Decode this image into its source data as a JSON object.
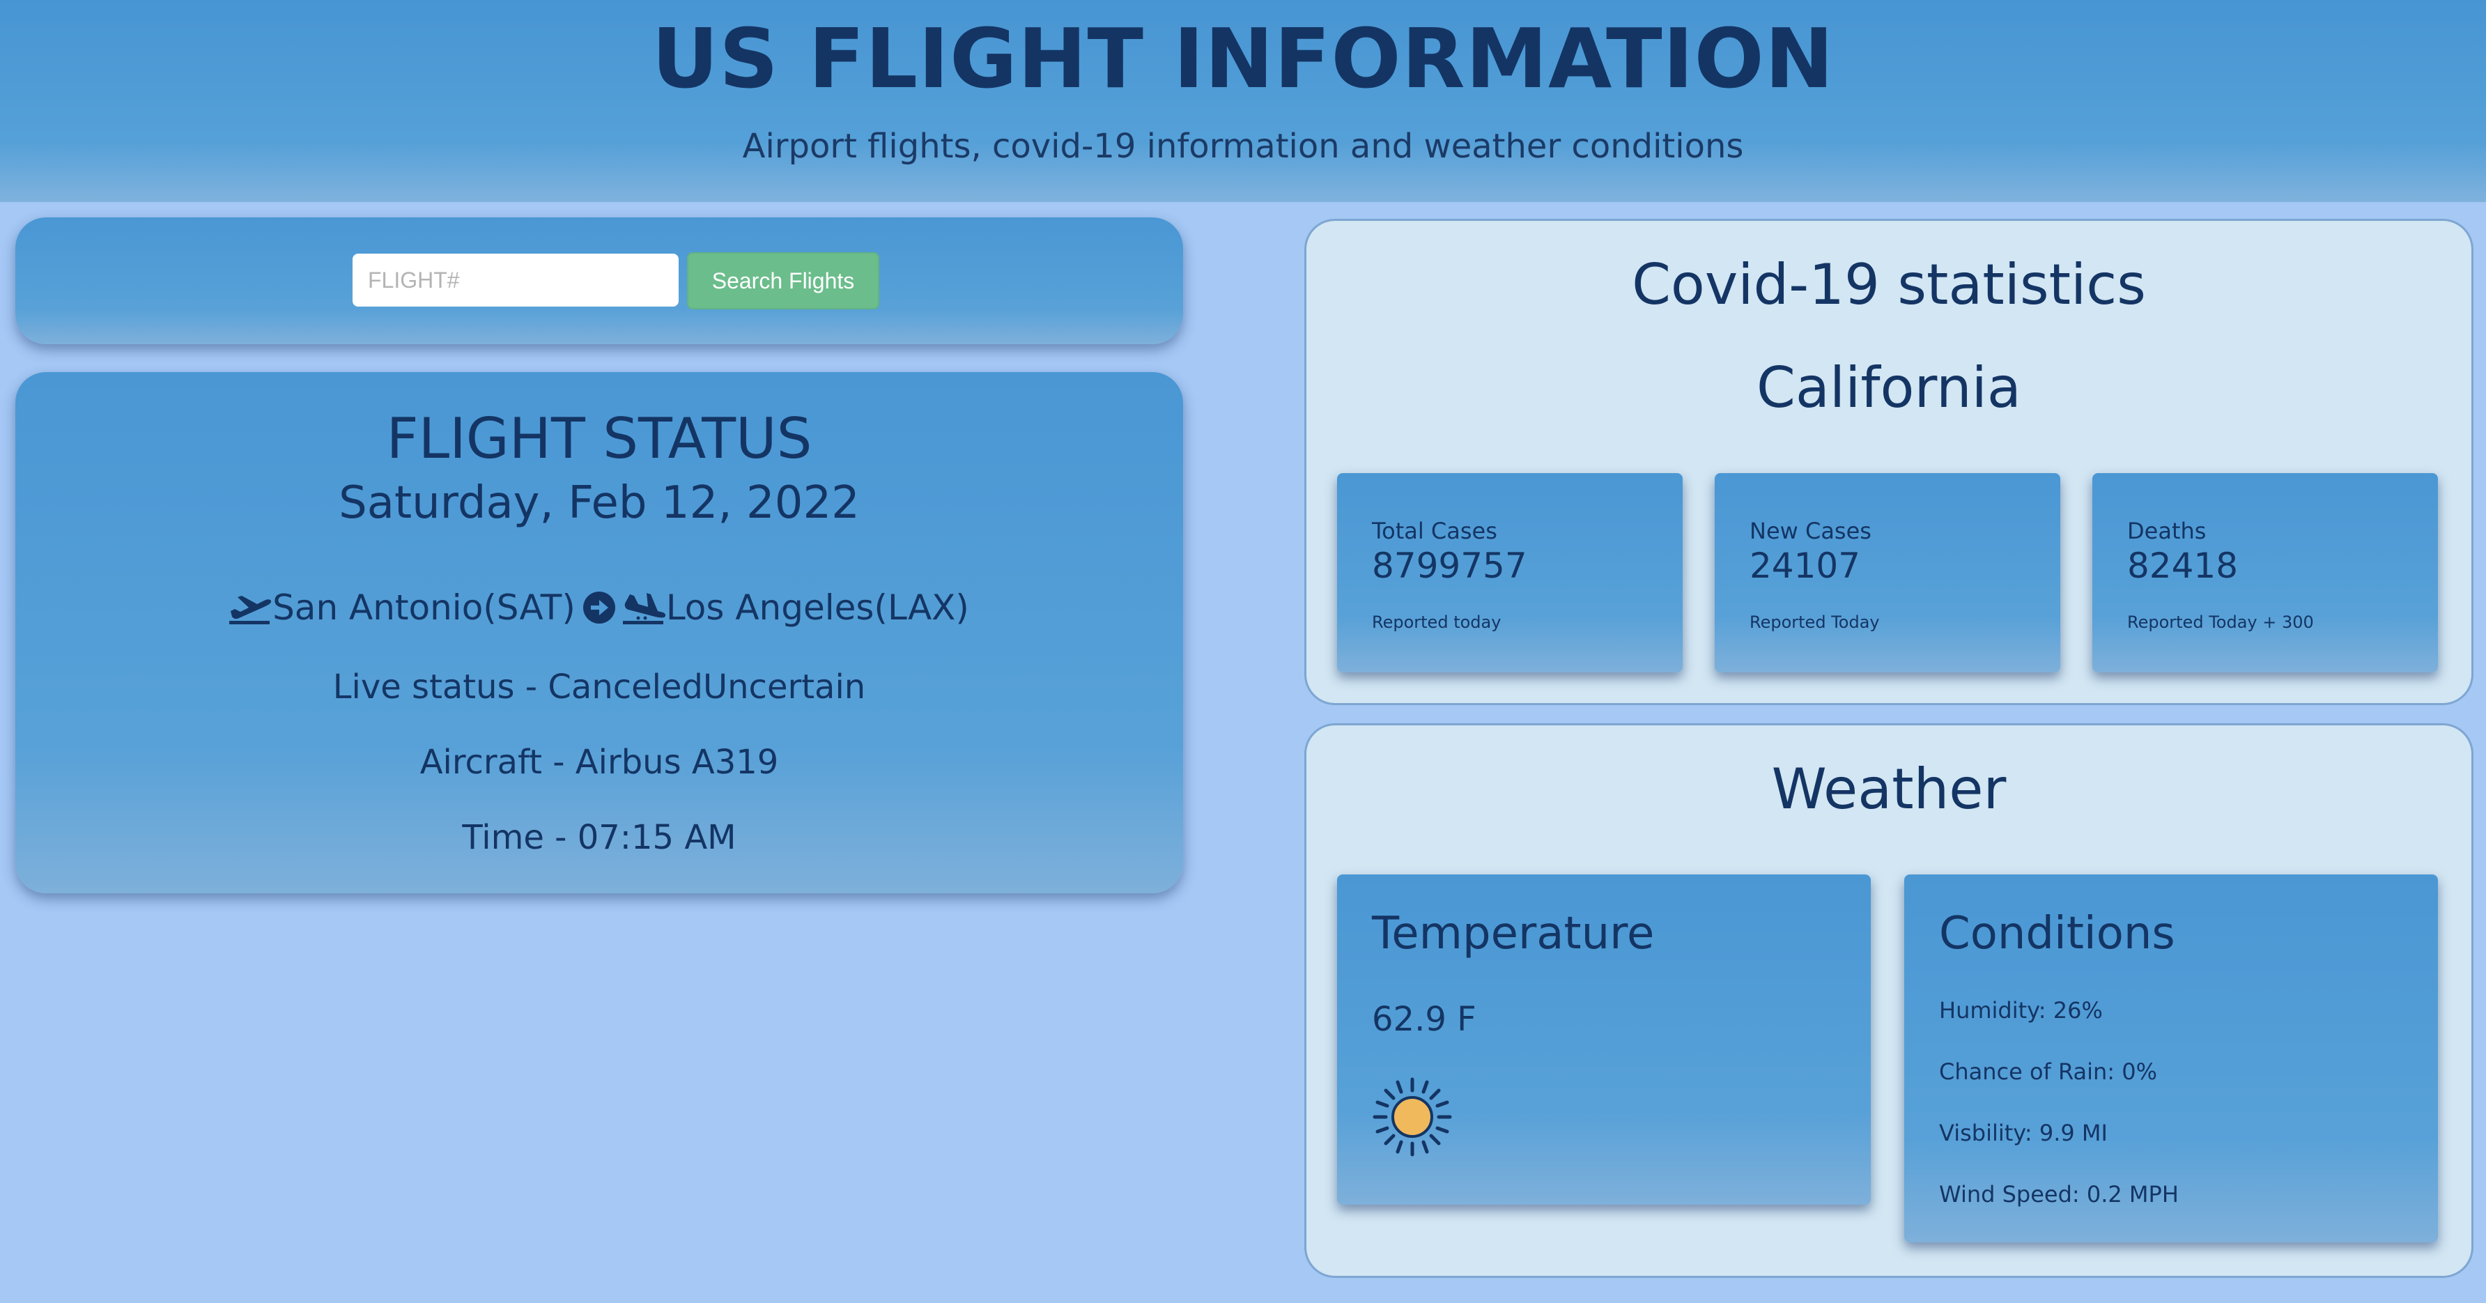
{
  "header": {
    "title": "US FLIGHT INFORMATION",
    "subtitle": "Airport flights, covid-19 information and weather conditions"
  },
  "search": {
    "placeholder": "FLIGHT#",
    "value": "",
    "button_label": "Search Flights"
  },
  "flight": {
    "heading": "FLIGHT STATUS",
    "date": "Saturday, Feb 12, 2022",
    "origin": "San Antonio(SAT)",
    "destination": "Los Angeles(LAX)",
    "live_status": "Live status - CanceledUncertain",
    "aircraft": "Aircraft - Airbus A319",
    "time": "Time - 07:15 AM",
    "icons": [
      "plane-departure-icon",
      "arrow-circle-right-icon",
      "plane-arrival-icon"
    ]
  },
  "covid": {
    "title": "Covid-19 statistics",
    "region": "California",
    "cards": [
      {
        "label": "Total Cases",
        "value": "8799757",
        "note": "Reported today"
      },
      {
        "label": "New Cases",
        "value": "24107",
        "note": "Reported Today"
      },
      {
        "label": "Deaths",
        "value": "82418",
        "note": "Reported Today + 300"
      }
    ]
  },
  "weather": {
    "title": "Weather",
    "temperature": {
      "heading": "Temperature",
      "value": "62.9 F",
      "icon": "sun-icon"
    },
    "conditions": {
      "heading": "Conditions",
      "humidity": "Humidity: 26%",
      "rain": "Chance of Rain: 0%",
      "visibility": "Visbility: 9.9 MI",
      "wind": "Wind Speed: 0.2 MPH"
    }
  },
  "colors": {
    "page_background": "#a5c8f5",
    "panel_blue": "#4a97d4",
    "light_panel": "#d2e6f3",
    "text_navy": "#143564",
    "button_green": "#6bbd8c",
    "sun_yellow": "#f0b95c"
  }
}
